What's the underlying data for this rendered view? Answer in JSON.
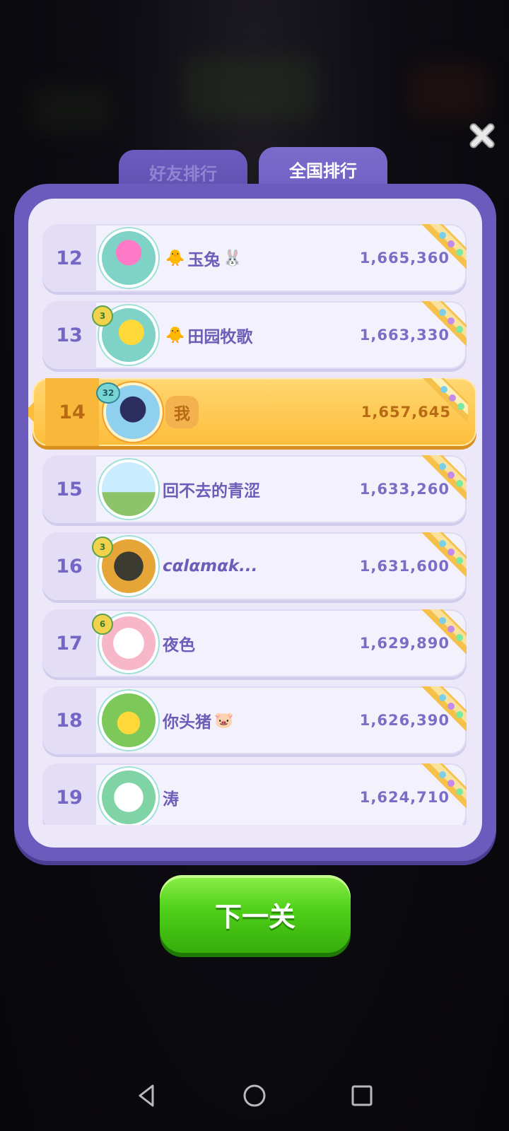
{
  "tabs": {
    "friends": "好友排行",
    "national": "全国排行"
  },
  "leaderboard": [
    {
      "rank": "12",
      "name": "玉兔",
      "prefix_emoji": "🐥",
      "suffix_emoji": "🐰",
      "score": "1,665,360",
      "level": ""
    },
    {
      "rank": "13",
      "name": "田园牧歌",
      "prefix_emoji": "🐥",
      "suffix_emoji": "",
      "score": "1,663,330",
      "level": "3"
    },
    {
      "rank": "14",
      "name": "我",
      "prefix_emoji": "",
      "suffix_emoji": "",
      "score": "1,657,645",
      "level": "32"
    },
    {
      "rank": "15",
      "name": "回不去的青涩",
      "prefix_emoji": "",
      "suffix_emoji": "",
      "score": "1,633,260",
      "level": ""
    },
    {
      "rank": "16",
      "name": "cαlαmαk...",
      "prefix_emoji": "",
      "suffix_emoji": "",
      "score": "1,631,600",
      "level": "3"
    },
    {
      "rank": "17",
      "name": "夜色",
      "prefix_emoji": "",
      "suffix_emoji": "",
      "score": "1,629,890",
      "level": "6"
    },
    {
      "rank": "18",
      "name": "你头猪",
      "prefix_emoji": "",
      "suffix_emoji": "🐷",
      "score": "1,626,390",
      "level": ""
    },
    {
      "rank": "19",
      "name": "涛",
      "prefix_emoji": "",
      "suffix_emoji": "",
      "score": "1,624,710",
      "level": ""
    }
  ],
  "next_button": "下一关",
  "colors": {
    "panel": "#6a5bbd",
    "row_bg": "#f3f1fc",
    "highlight": "#fdbd3a",
    "next_green": "#4fcf18"
  }
}
